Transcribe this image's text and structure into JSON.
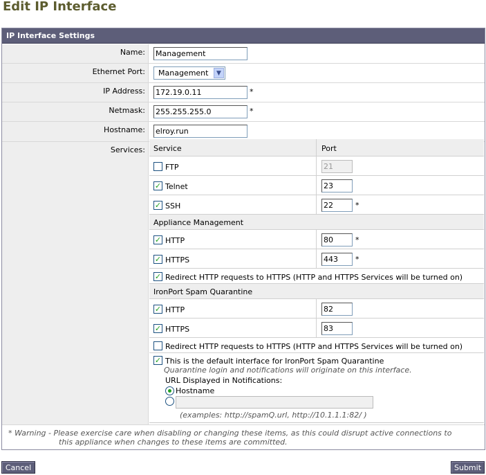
{
  "page_title": "Edit IP Interface",
  "panel_title": "IP Interface Settings",
  "fields": {
    "name_label": "Name:",
    "name_value": "Management",
    "ethernet_label": "Ethernet Port:",
    "ethernet_value": "Management",
    "ip_label": "IP Address:",
    "ip_value": "172.19.0.11",
    "netmask_label": "Netmask:",
    "netmask_value": "255.255.255.0",
    "hostname_label": "Hostname:",
    "hostname_value": "elroy.run",
    "required_mark": "*"
  },
  "services": {
    "label": "Services:",
    "col_service": "Service",
    "col_port": "Port",
    "ftp": {
      "label": "FTP",
      "checked": false,
      "port": "21"
    },
    "telnet": {
      "label": "Telnet",
      "checked": true,
      "port": "23"
    },
    "ssh": {
      "label": "SSH",
      "checked": true,
      "port": "22"
    },
    "appliance_mgmt_header": "Appliance Management",
    "am_http": {
      "label": "HTTP",
      "checked": true,
      "port": "80"
    },
    "am_https": {
      "label": "HTTPS",
      "checked": true,
      "port": "443"
    },
    "am_redirect": {
      "label": "Redirect HTTP requests to HTTPS (HTTP and HTTPS Services will be turned on)",
      "checked": true
    },
    "spam_quarantine_header": "IronPort Spam Quarantine",
    "sq_http": {
      "label": "HTTP",
      "checked": true,
      "port": "82"
    },
    "sq_https": {
      "label": "HTTPS",
      "checked": true,
      "port": "83"
    },
    "sq_redirect": {
      "label": "Redirect HTTP requests to HTTPS (HTTP and HTTPS Services will be turned on)",
      "checked": false
    },
    "default_interface": {
      "label": "This is the default interface for IronPort Spam Quarantine",
      "checked": true,
      "note": "Quarantine login and notifications will originate on this interface.",
      "url_label": "URL Displayed in Notifications:",
      "radio_hostname_label": "Hostname",
      "radio_hostname_selected": true,
      "custom_url_value": "",
      "examples": "(examples: http://spamQ.url, http://10.1.1.1:82/ )"
    },
    "check_glyph": "✓"
  },
  "warning": "* Warning -  Please exercise care when disabling or changing these items, as this could disrupt active connections to\n                    this appliance when changes to these items are committed.",
  "warning_line1": "* Warning -  Please exercise care when disabling or changing these items, as this could disrupt active connections to",
  "warning_line2": "this appliance when changes to these items are committed.",
  "buttons": {
    "cancel": "Cancel",
    "submit": "Submit"
  },
  "colors": {
    "title": "#5c5c2e",
    "header_bg": "#5d5e79",
    "check": "#21a121"
  }
}
